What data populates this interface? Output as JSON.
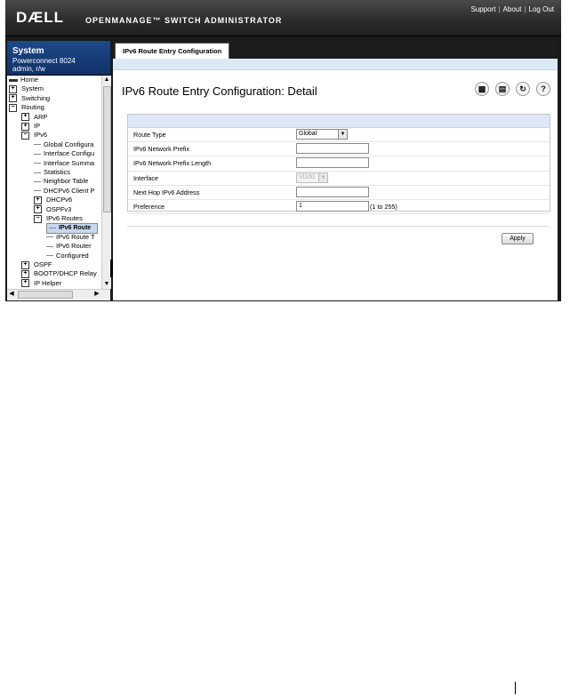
{
  "header": {
    "logo": "DÆLL",
    "product": "OPENMANAGE™ SWITCH ADMINISTRATOR",
    "links": [
      "Support",
      "About",
      "Log Out"
    ]
  },
  "system_box": {
    "title": "System",
    "model": "Powerconnect 8024",
    "user": "admin, r/w"
  },
  "tree": [
    {
      "label": "Home",
      "kind": "home"
    },
    {
      "label": "System",
      "kind": "plus"
    },
    {
      "label": "Switching",
      "kind": "plus"
    },
    {
      "label": "Routing",
      "kind": "minus"
    },
    {
      "label": "ARP",
      "kind": "plus"
    },
    {
      "label": "IP",
      "kind": "plus"
    },
    {
      "label": "IPv6",
      "kind": "minus"
    },
    {
      "label": "Global Configura",
      "kind": "leaf"
    },
    {
      "label": "Interface Configu",
      "kind": "leaf"
    },
    {
      "label": "Interface Summa",
      "kind": "leaf"
    },
    {
      "label": "Statistics",
      "kind": "leaf"
    },
    {
      "label": "Neighbor Table",
      "kind": "leaf"
    },
    {
      "label": "DHCPv6 Client P",
      "kind": "leaf"
    },
    {
      "label": "DHCPv6",
      "kind": "plus"
    },
    {
      "label": "OSPFv3",
      "kind": "plus"
    },
    {
      "label": "IPv6 Routes",
      "kind": "minus"
    },
    {
      "label": "IPv6 Route",
      "kind": "leaf",
      "selected": true
    },
    {
      "label": "IPv6 Route T",
      "kind": "leaf"
    },
    {
      "label": "IPv6 Router",
      "kind": "leaf"
    },
    {
      "label": "Configured",
      "kind": "leaf"
    },
    {
      "label": "OSPF",
      "kind": "plus"
    },
    {
      "label": "BOOTP/DHCP Relay",
      "kind": "plus"
    },
    {
      "label": "IP Helper",
      "kind": "plus"
    }
  ],
  "tab": {
    "label": "IPv6 Route Entry Configuration"
  },
  "page_title": "IPv6 Route Entry Configuration: Detail",
  "toolbar_icons": [
    "save-icon",
    "print-icon",
    "refresh-icon",
    "help-icon"
  ],
  "form": {
    "route_type": {
      "label": "Route Type",
      "value": "Global"
    },
    "prefix": {
      "label": "IPv6 Network Prefix",
      "value": ""
    },
    "prefix_length": {
      "label": "IPv6 Network Prefix Length",
      "value": ""
    },
    "interface": {
      "label": "Interface",
      "value": "Vl100"
    },
    "next_hop": {
      "label": "Next Hop IPv6 Address",
      "value": ""
    },
    "preference": {
      "label": "Preference",
      "value": "1",
      "hint": "(1 to 255)"
    }
  },
  "apply_label": "Apply"
}
